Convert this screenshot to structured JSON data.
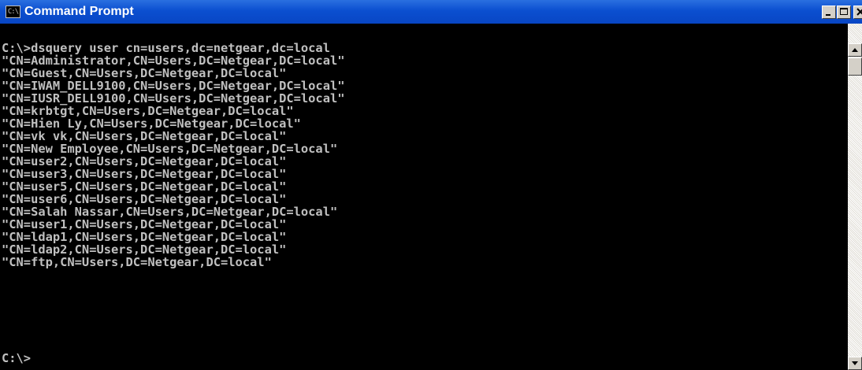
{
  "window": {
    "title": "Command Prompt",
    "app_icon_text": "C:\\",
    "controls": [
      "minimize",
      "maximize",
      "close"
    ]
  },
  "console": {
    "lines": [
      "C:\\>dsquery user cn=users,dc=netgear,dc=local",
      "\"CN=Administrator,CN=Users,DC=Netgear,DC=local\"",
      "\"CN=Guest,CN=Users,DC=Netgear,DC=local\"",
      "\"CN=IWAM_DELL9100,CN=Users,DC=Netgear,DC=local\"",
      "\"CN=IUSR_DELL9100,CN=Users,DC=Netgear,DC=local\"",
      "\"CN=krbtgt,CN=Users,DC=Netgear,DC=local\"",
      "\"CN=Hien Ly,CN=Users,DC=Netgear,DC=local\"",
      "\"CN=vk vk,CN=Users,DC=Netgear,DC=local\"",
      "\"CN=New Employee,CN=Users,DC=Netgear,DC=local\"",
      "\"CN=user2,CN=Users,DC=Netgear,DC=local\"",
      "\"CN=user3,CN=Users,DC=Netgear,DC=local\"",
      "\"CN=user5,CN=Users,DC=Netgear,DC=local\"",
      "\"CN=user6,CN=Users,DC=Netgear,DC=local\"",
      "\"CN=Salah Nassar,CN=Users,DC=Netgear,DC=local\"",
      "\"CN=user1,CN=Users,DC=Netgear,DC=local\"",
      "\"CN=ldap1,CN=Users,DC=Netgear,DC=local\"",
      "\"CN=ldap2,CN=Users,DC=Netgear,DC=local\"",
      "\"CN=ftp,CN=Users,DC=Netgear,DC=local\""
    ],
    "prompt": "C:\\>"
  },
  "colors": {
    "console_background": "#000000",
    "console_text": "#c0c0c0",
    "titlebar": "#0b4fd0"
  }
}
